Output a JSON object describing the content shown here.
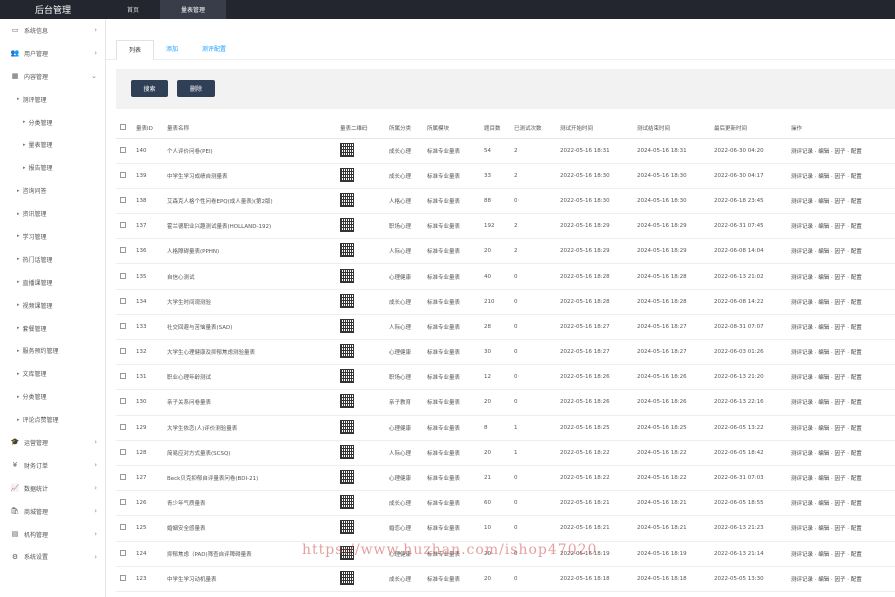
{
  "topbar": {
    "brand": "后台管理",
    "tabs": [
      {
        "label": "首页"
      },
      {
        "label": "量表管理"
      }
    ]
  },
  "sidebar": {
    "items": [
      {
        "label": "系统信息",
        "icon": "monitor-icon",
        "glyph": "▭",
        "arrow": "›"
      },
      {
        "label": "用户管理",
        "icon": "users-icon",
        "glyph": "👥",
        "arrow": "›"
      },
      {
        "label": "内容管理",
        "icon": "grid-icon",
        "glyph": "▦",
        "arrow": "⌄"
      },
      {
        "label": "测评管理",
        "level": 2,
        "arrow": ""
      },
      {
        "label": "分类管理",
        "level": 3
      },
      {
        "label": "量表管理",
        "level": 3
      },
      {
        "label": "报告管理",
        "level": 3
      },
      {
        "label": "咨询问答",
        "level": 2
      },
      {
        "label": "资讯管理",
        "level": 2
      },
      {
        "label": "学习管理",
        "level": 2
      },
      {
        "label": "热门话管理",
        "level": 2
      },
      {
        "label": "直播课管理",
        "level": 2
      },
      {
        "label": "视频课管理",
        "level": 2
      },
      {
        "label": "套餐管理",
        "level": 2
      },
      {
        "label": "服务预约管理",
        "level": 2
      },
      {
        "label": "文库管理",
        "level": 2
      },
      {
        "label": "分类管理",
        "level": 2
      },
      {
        "label": "评论点赞管理",
        "level": 2
      },
      {
        "label": "运营管理",
        "icon": "graduation-icon",
        "glyph": "🎓",
        "arrow": "›"
      },
      {
        "label": "财务订单",
        "icon": "yen-icon",
        "glyph": "¥",
        "arrow": "›"
      },
      {
        "label": "数据统计",
        "icon": "chart-icon",
        "glyph": "📈",
        "arrow": "›"
      },
      {
        "label": "商城管理",
        "icon": "shop-icon",
        "glyph": "🛍",
        "arrow": "›"
      },
      {
        "label": "机构管理",
        "icon": "building-icon",
        "glyph": "▤",
        "arrow": "›"
      },
      {
        "label": "系统设置",
        "icon": "gear-icon",
        "glyph": "⚙",
        "arrow": "›"
      }
    ]
  },
  "subtabs": [
    {
      "label": "列表"
    },
    {
      "label": "添加"
    },
    {
      "label": "测评配置"
    }
  ],
  "toolbar": {
    "search_label": "搜索",
    "delete_label": "删除"
  },
  "table": {
    "headers": [
      "量表ID",
      "量表名称",
      "量表二维码",
      "所属分类",
      "所属模块",
      "题目数",
      "已测试次数",
      "测试开始时间",
      "测试结束时间",
      "最后更新时间",
      "操作"
    ],
    "rows": [
      {
        "id": "140",
        "name": "个人评价问卷(PEI)",
        "category": "成长心理",
        "module": "标准专业量表",
        "questions": "54",
        "tests": "2",
        "start": "2022-05-16 18:31",
        "end": "2024-05-16 18:31",
        "updated": "2022-06-30 04:20"
      },
      {
        "id": "139",
        "name": "中学生学习成绩自测量表",
        "category": "成长心理",
        "module": "标准专业量表",
        "questions": "33",
        "tests": "2",
        "start": "2022-05-16 18:30",
        "end": "2024-05-16 18:30",
        "updated": "2022-06-30 04:17"
      },
      {
        "id": "138",
        "name": "艾森克人格个性问卷EPQ(成人量表)(第2版)",
        "category": "人格心理",
        "module": "标准专业量表",
        "questions": "88",
        "tests": "0",
        "start": "2022-05-16 18:30",
        "end": "2024-05-16 18:30",
        "updated": "2022-06-18 23:45"
      },
      {
        "id": "137",
        "name": "霍兰德职业兴趣测试量表(HOLLAND-192)",
        "category": "职场心理",
        "module": "标准专业量表",
        "questions": "192",
        "tests": "2",
        "start": "2022-05-16 18:29",
        "end": "2024-05-16 18:29",
        "updated": "2022-06-31 07:45"
      },
      {
        "id": "136",
        "name": "人格障碍量表(PPHN)",
        "category": "人际心理",
        "module": "标准专业量表",
        "questions": "20",
        "tests": "2",
        "start": "2022-05-16 18:29",
        "end": "2024-05-16 18:29",
        "updated": "2022-06-08 14:04"
      },
      {
        "id": "135",
        "name": "自信心测试",
        "category": "心理健康",
        "module": "标准专业量表",
        "questions": "40",
        "tests": "0",
        "start": "2022-05-16 18:28",
        "end": "2024-05-16 18:28",
        "updated": "2022-06-13 21:02"
      },
      {
        "id": "134",
        "name": "大学生时间观测验",
        "category": "成长心理",
        "module": "标准专业量表",
        "questions": "210",
        "tests": "0",
        "start": "2022-05-16 18:28",
        "end": "2024-05-16 18:28",
        "updated": "2022-06-08 14:22"
      },
      {
        "id": "133",
        "name": "社交回避与苦恼量表(SAD)",
        "category": "人际心理",
        "module": "标准专业量表",
        "questions": "28",
        "tests": "0",
        "start": "2022-05-16 18:27",
        "end": "2024-05-16 18:27",
        "updated": "2022-08-31 07:07"
      },
      {
        "id": "132",
        "name": "大学生心理健康及抑郁焦虑测验量表",
        "category": "心理健康",
        "module": "标准专业量表",
        "questions": "30",
        "tests": "0",
        "start": "2022-05-16 18:27",
        "end": "2024-05-16 18:27",
        "updated": "2022-06-03 01:26"
      },
      {
        "id": "131",
        "name": "职业心理年龄测试",
        "category": "职场心理",
        "module": "标准专业量表",
        "questions": "12",
        "tests": "0",
        "start": "2022-05-16 18:26",
        "end": "2024-05-16 18:26",
        "updated": "2022-06-13 21:20"
      },
      {
        "id": "130",
        "name": "亲子关系问卷量表",
        "category": "亲子教育",
        "module": "标准专业量表",
        "questions": "20",
        "tests": "0",
        "start": "2022-05-16 18:26",
        "end": "2024-05-16 18:26",
        "updated": "2022-06-13 22:16"
      },
      {
        "id": "129",
        "name": "大学生依恋(人)评价测验量表",
        "category": "心理健康",
        "module": "标准专业量表",
        "questions": "8",
        "tests": "1",
        "start": "2022-05-16 18:25",
        "end": "2024-05-16 18:25",
        "updated": "2022-06-05 13:22"
      },
      {
        "id": "128",
        "name": "简易应对方式量表(SCSQ)",
        "category": "人际心理",
        "module": "标准专业量表",
        "questions": "20",
        "tests": "1",
        "start": "2022-05-16 18:22",
        "end": "2024-05-16 18:22",
        "updated": "2022-06-05 18:42"
      },
      {
        "id": "127",
        "name": "Beck贝克抑郁自评量表问卷(BDI-21)",
        "category": "心理健康",
        "module": "标准专业量表",
        "questions": "21",
        "tests": "0",
        "start": "2022-05-16 18:22",
        "end": "2024-05-16 18:22",
        "updated": "2022-06-31 07:03"
      },
      {
        "id": "126",
        "name": "青少年气质量表",
        "category": "成长心理",
        "module": "标准专业量表",
        "questions": "60",
        "tests": "0",
        "start": "2022-05-16 18:21",
        "end": "2024-05-16 18:21",
        "updated": "2022-06-05 18:55"
      },
      {
        "id": "125",
        "name": "婚姻安全感量表",
        "category": "婚恋心理",
        "module": "标准专业量表",
        "questions": "10",
        "tests": "0",
        "start": "2022-05-16 18:21",
        "end": "2024-05-16 18:21",
        "updated": "2022-06-13 21:23"
      },
      {
        "id": "124",
        "name": "抑郁焦虑（PAD)筛查自评障碍量表",
        "category": "心理健康",
        "module": "标准专业量表",
        "questions": "20",
        "tests": "0",
        "start": "2022-05-16 18:19",
        "end": "2024-05-16 18:19",
        "updated": "2022-06-13 21:14"
      },
      {
        "id": "123",
        "name": "中学生学习动机量表",
        "category": "成长心理",
        "module": "标准专业量表",
        "questions": "20",
        "tests": "0",
        "start": "2022-05-16 18:18",
        "end": "2024-05-16 18:18",
        "updated": "2022-05-05 13:30"
      }
    ],
    "actions": "测评记录 · 编辑 · 因子 · 配置"
  },
  "watermark": "https://www.huzhan.com/ishop47020"
}
